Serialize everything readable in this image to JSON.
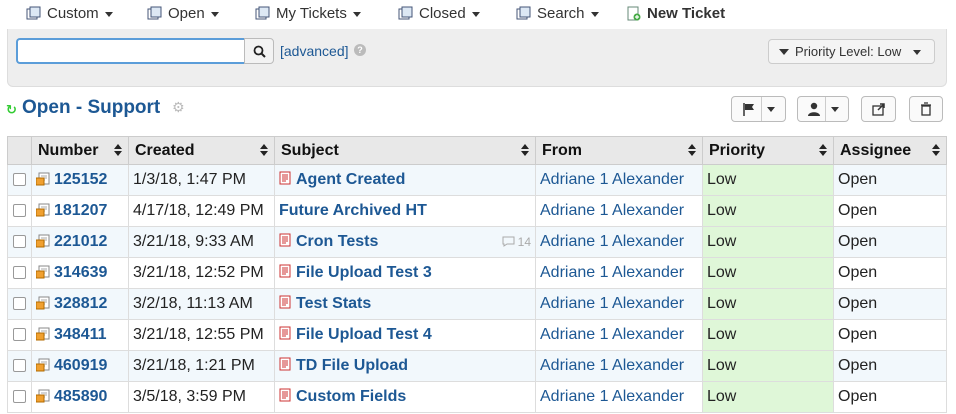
{
  "nav": {
    "custom": "Custom",
    "open": "Open",
    "my_tickets": "My Tickets",
    "closed": "Closed",
    "search": "Search",
    "new_ticket": "New Ticket"
  },
  "search": {
    "value": "",
    "placeholder": "",
    "advanced": "[advanced]",
    "help": "?"
  },
  "priority_filter": "Priority Level: Low",
  "queue": {
    "title": "Open - Support"
  },
  "table": {
    "headers": [
      "Number",
      "Created",
      "Subject",
      "From",
      "Priority",
      "Assignee"
    ],
    "rows": [
      {
        "number": "125152",
        "created": "1/3/18, 1:47 PM",
        "subject": "Agent Created",
        "from": "Adriane 1 Alexander",
        "priority": "Low",
        "assignee": "Open",
        "subject_icon": true,
        "thread": ""
      },
      {
        "number": "181207",
        "created": "4/17/18, 12:49 PM",
        "subject": "Future Archived HT",
        "from": "Adriane 1 Alexander",
        "priority": "Low",
        "assignee": "Open",
        "subject_icon": false,
        "thread": ""
      },
      {
        "number": "221012",
        "created": "3/21/18, 9:33 AM",
        "subject": "Cron Tests",
        "from": "Adriane 1 Alexander",
        "priority": "Low",
        "assignee": "Open",
        "subject_icon": true,
        "thread": "14"
      },
      {
        "number": "314639",
        "created": "3/21/18, 12:52 PM",
        "subject": "File Upload Test 3",
        "from": "Adriane 1 Alexander",
        "priority": "Low",
        "assignee": "Open",
        "subject_icon": true,
        "thread": ""
      },
      {
        "number": "328812",
        "created": "3/2/18, 11:13 AM",
        "subject": "Test Stats",
        "from": "Adriane 1 Alexander",
        "priority": "Low",
        "assignee": "Open",
        "subject_icon": true,
        "thread": ""
      },
      {
        "number": "348411",
        "created": "3/21/18, 12:55 PM",
        "subject": "File Upload Test 4",
        "from": "Adriane 1 Alexander",
        "priority": "Low",
        "assignee": "Open",
        "subject_icon": true,
        "thread": ""
      },
      {
        "number": "460919",
        "created": "3/21/18, 1:21 PM",
        "subject": "TD File Upload",
        "from": "Adriane 1 Alexander",
        "priority": "Low",
        "assignee": "Open",
        "subject_icon": true,
        "thread": ""
      },
      {
        "number": "485890",
        "created": "3/5/18, 3:59 PM",
        "subject": "Custom Fields",
        "from": "Adriane 1 Alexander",
        "priority": "Low",
        "assignee": "Open",
        "subject_icon": true,
        "thread": ""
      }
    ]
  },
  "colors": {
    "link": "#1d5894",
    "priority_low_bg": "#dff7d8",
    "row_alt": "#f2f8fc",
    "refresh": "#33cc33"
  }
}
